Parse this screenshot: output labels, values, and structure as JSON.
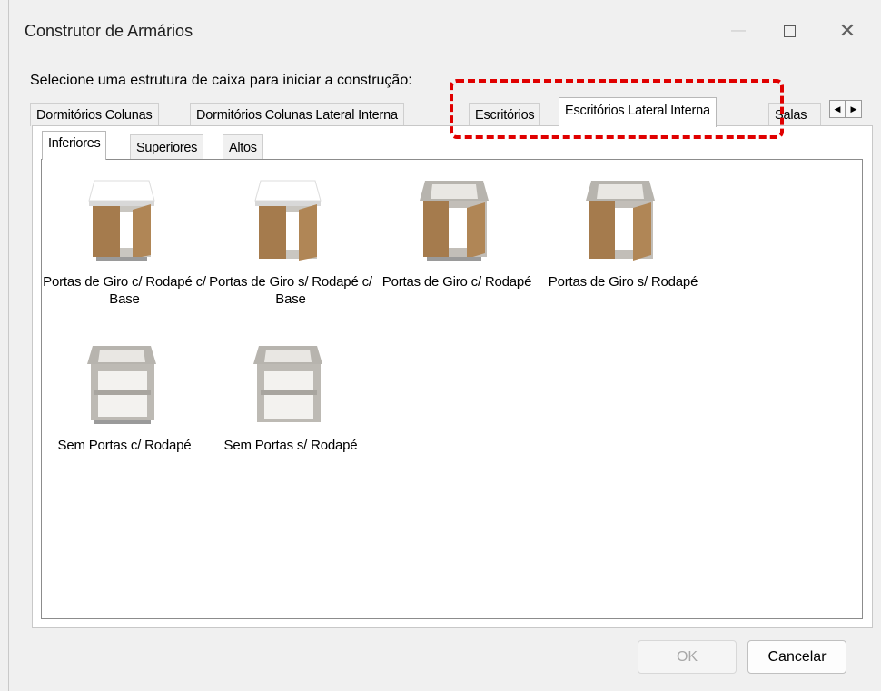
{
  "window": {
    "title": "Construtor de Armários",
    "minimize": "—",
    "close": "✕"
  },
  "instruction": "Selecione uma estrutura de caixa para iniciar a construção:",
  "tabs": [
    {
      "label": "Dormitórios Colunas",
      "active": false
    },
    {
      "label": "Dormitórios Colunas Lateral Interna",
      "active": false
    },
    {
      "label": "Escritórios",
      "active": false
    },
    {
      "label": "Escritórios Lateral Interna",
      "active": true
    },
    {
      "label": "Salas",
      "active": false
    }
  ],
  "subtabs": [
    {
      "label": "Inferiores",
      "active": true
    },
    {
      "label": "Superiores",
      "active": false
    },
    {
      "label": "Altos",
      "active": false
    }
  ],
  "items": [
    {
      "label": "Portas de Giro c/ Rodapé c/ Base",
      "icon": "cabinet-doors-white-top-icon"
    },
    {
      "label": "Portas de Giro s/ Rodapé c/ Base",
      "icon": "cabinet-doors-white-top-icon"
    },
    {
      "label": "Portas de Giro c/ Rodapé",
      "icon": "cabinet-doors-open-top-icon"
    },
    {
      "label": "Portas de Giro s/ Rodapé",
      "icon": "cabinet-doors-open-top-icon"
    },
    {
      "label": "Sem Portas c/ Rodapé",
      "icon": "cabinet-no-doors-icon"
    },
    {
      "label": "Sem Portas s/ Rodapé",
      "icon": "cabinet-no-doors-icon"
    }
  ],
  "buttons": {
    "ok": "OK",
    "cancel": "Cancelar"
  },
  "colors": {
    "highlight": "#e00000",
    "wood": "#a0784c",
    "carcass": "#bdbab4"
  }
}
